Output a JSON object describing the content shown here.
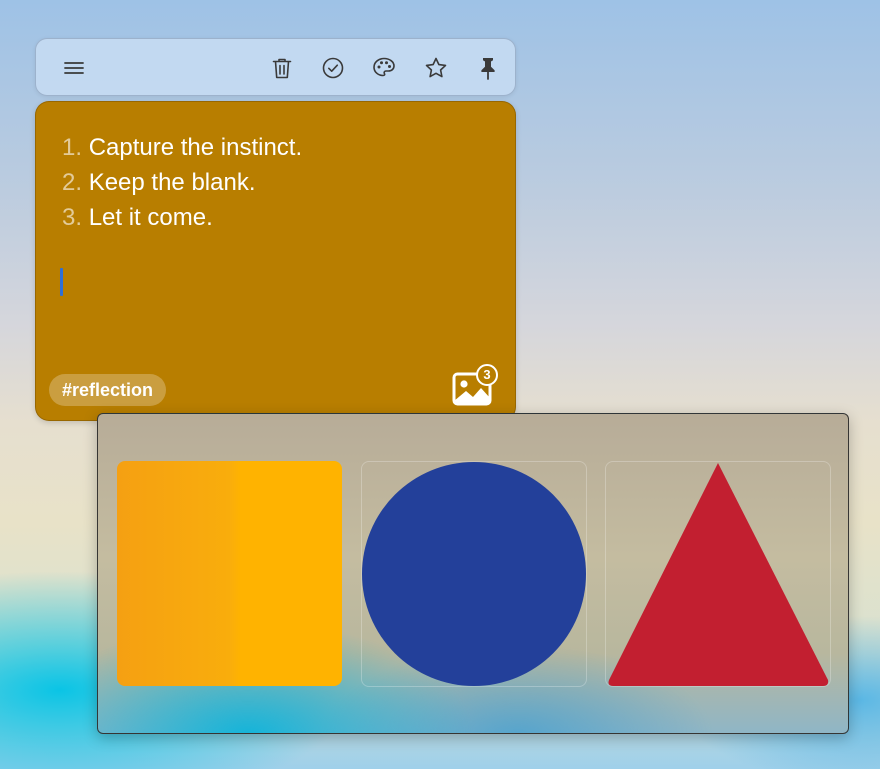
{
  "toolbar": {
    "icons": [
      "menu-icon",
      "trash-icon",
      "checkmark-circle-icon",
      "palette-icon",
      "star-icon",
      "pin-icon"
    ]
  },
  "note": {
    "background": "#b87e00",
    "items": [
      {
        "number": "1.",
        "text": "Capture the instinct."
      },
      {
        "number": "2.",
        "text": "Keep the blank."
      },
      {
        "number": "3.",
        "text": "Let it come."
      }
    ],
    "tag": "#reflection",
    "image_count": "3"
  },
  "gallery": {
    "images": [
      {
        "shape": "square",
        "color": "#ffb300"
      },
      {
        "shape": "circle",
        "color": "#23409a"
      },
      {
        "shape": "triangle",
        "color": "#c21f30"
      }
    ]
  }
}
